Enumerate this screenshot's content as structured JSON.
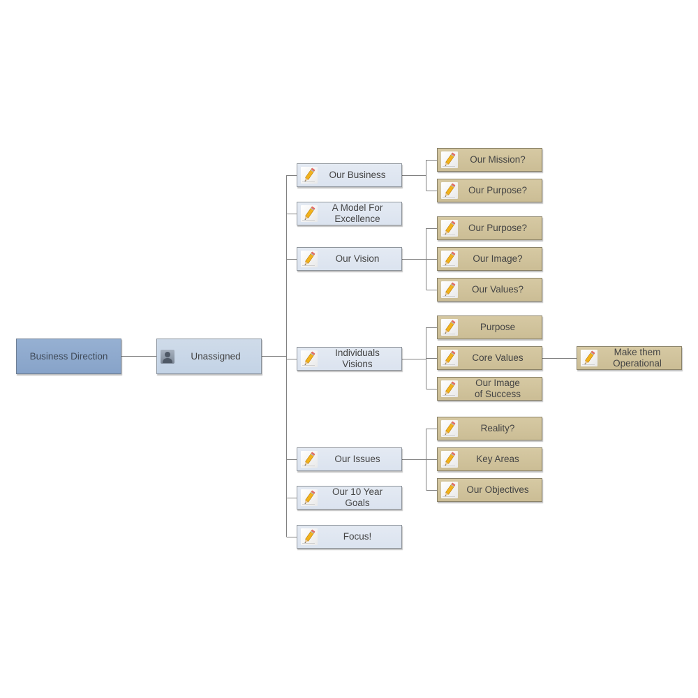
{
  "diagram": {
    "type": "mind-map",
    "root": {
      "label": "Business Direction"
    },
    "branch": {
      "label": "Unassigned",
      "icon": "user-avatar-icon"
    },
    "topics": [
      {
        "label": "Our Business",
        "icon": "pencil-icon",
        "children": [
          {
            "label": "Our Mission?"
          },
          {
            "label": "Our Purpose?"
          }
        ]
      },
      {
        "label": "A Model For\nExcellence",
        "icon": "pencil-icon",
        "children": []
      },
      {
        "label": "Our Vision",
        "icon": "pencil-icon",
        "children": [
          {
            "label": "Our Purpose?"
          },
          {
            "label": "Our Image?"
          },
          {
            "label": "Our Values?"
          }
        ]
      },
      {
        "label": "Individuals\nVisions",
        "icon": "pencil-icon",
        "children": [
          {
            "label": "Purpose"
          },
          {
            "label": "Core Values",
            "children": [
              {
                "label": "Make them\nOperational"
              }
            ]
          },
          {
            "label": "Our Image\nof Success"
          }
        ]
      },
      {
        "label": "Our Issues",
        "icon": "pencil-icon",
        "children": [
          {
            "label": "Reality?"
          },
          {
            "label": "Key Areas"
          },
          {
            "label": "Our Objectives"
          }
        ]
      },
      {
        "label": "Our 10 Year\nGoals",
        "icon": "pencil-icon",
        "children": []
      },
      {
        "label": "Focus!",
        "icon": "pencil-icon",
        "children": []
      }
    ],
    "colors": {
      "root_fill": "#8ea8cd",
      "branch_fill": "#c9d7e8",
      "topic_fill": "#dfe6f1",
      "subtopic_fill": "#cfc29b",
      "connector": "#808080"
    }
  }
}
